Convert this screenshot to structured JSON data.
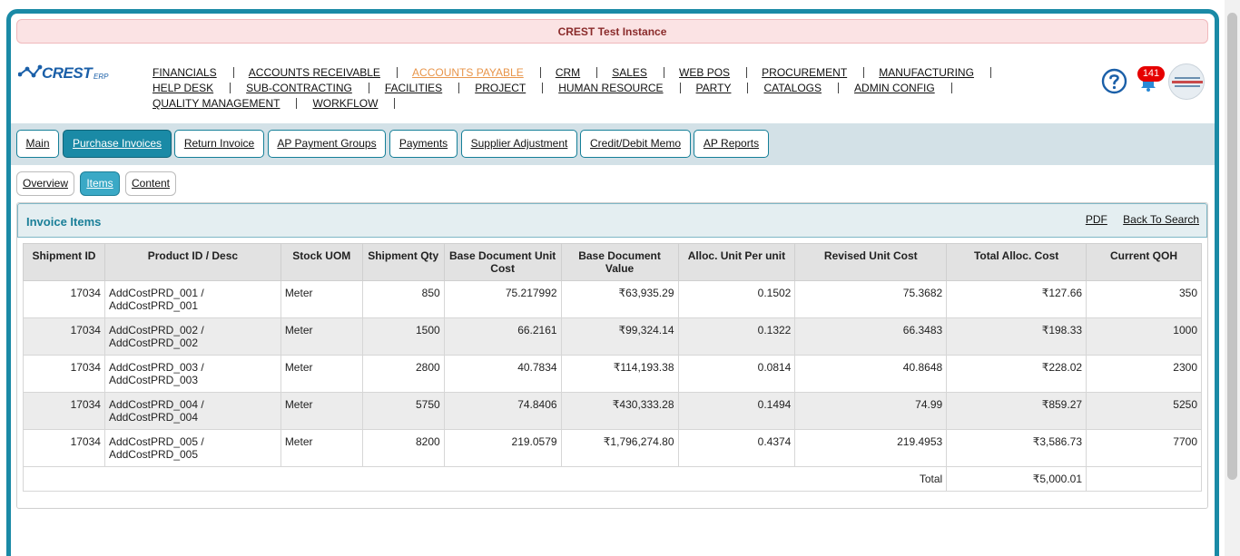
{
  "banner": "CREST Test Instance",
  "logo": {
    "text": "CREST",
    "suffix": "ERP"
  },
  "nav": {
    "rows": [
      [
        "FINANCIALS",
        "ACCOUNTS RECEIVABLE",
        "ACCOUNTS PAYABLE",
        "CRM",
        "SALES",
        "WEB POS",
        "PROCUREMENT",
        "MANUFACTURING"
      ],
      [
        "HELP DESK",
        "SUB-CONTRACTING",
        "FACILITIES",
        "PROJECT",
        "HUMAN RESOURCE",
        "PARTY",
        "CATALOGS",
        "ADMIN CONFIG"
      ],
      [
        "QUALITY MANAGEMENT",
        "WORKFLOW"
      ]
    ],
    "active": "ACCOUNTS PAYABLE"
  },
  "header": {
    "notification_count": "141",
    "help_icon": "question-circle-icon",
    "bell_icon": "bell-icon"
  },
  "tabs": [
    "Main",
    "Purchase Invoices",
    "Return Invoice",
    "AP Payment Groups",
    "Payments",
    "Supplier Adjustment",
    "Credit/Debit Memo",
    "AP Reports"
  ],
  "active_tab": "Purchase Invoices",
  "subtabs": [
    "Overview",
    "Items",
    "Content"
  ],
  "active_subtab": "Items",
  "panel": {
    "title": "Invoice Items",
    "pdf_link": "PDF",
    "back_link": "Back To Search"
  },
  "table": {
    "headers": [
      "Shipment ID",
      "Product ID / Desc",
      "Stock UOM",
      "Shipment Qty",
      "Base Document Unit Cost",
      "Base Document Value",
      "Alloc. Unit Per unit",
      "Revised Unit Cost",
      "Total Alloc. Cost",
      "Current QOH"
    ],
    "rows": [
      {
        "shipment_id": "17034",
        "product_line1": "AddCostPRD_001 /",
        "product_line2": "AddCostPRD_001",
        "uom": "Meter",
        "qty": "850",
        "unit_cost": "75.217992",
        "doc_value": "₹63,935.29",
        "alloc_unit": "0.1502",
        "revised_cost": "75.3682",
        "total_alloc": "₹127.66",
        "qoh": "350"
      },
      {
        "shipment_id": "17034",
        "product_line1": "AddCostPRD_002 /",
        "product_line2": "AddCostPRD_002",
        "uom": "Meter",
        "qty": "1500",
        "unit_cost": "66.2161",
        "doc_value": "₹99,324.14",
        "alloc_unit": "0.1322",
        "revised_cost": "66.3483",
        "total_alloc": "₹198.33",
        "qoh": "1000"
      },
      {
        "shipment_id": "17034",
        "product_line1": "AddCostPRD_003 /",
        "product_line2": "AddCostPRD_003",
        "uom": "Meter",
        "qty": "2800",
        "unit_cost": "40.7834",
        "doc_value": "₹114,193.38",
        "alloc_unit": "0.0814",
        "revised_cost": "40.8648",
        "total_alloc": "₹228.02",
        "qoh": "2300"
      },
      {
        "shipment_id": "17034",
        "product_line1": "AddCostPRD_004 /",
        "product_line2": "AddCostPRD_004",
        "uom": "Meter",
        "qty": "5750",
        "unit_cost": "74.8406",
        "doc_value": "₹430,333.28",
        "alloc_unit": "0.1494",
        "revised_cost": "74.99",
        "total_alloc": "₹859.27",
        "qoh": "5250"
      },
      {
        "shipment_id": "17034",
        "product_line1": "AddCostPRD_005 /",
        "product_line2": "AddCostPRD_005",
        "uom": "Meter",
        "qty": "8200",
        "unit_cost": "219.0579",
        "doc_value": "₹1,796,274.80",
        "alloc_unit": "0.4374",
        "revised_cost": "219.4953",
        "total_alloc": "₹3,586.73",
        "qoh": "7700"
      }
    ],
    "total_label": "Total",
    "total_value": "₹5,000.01"
  },
  "colors": {
    "accent": "#1a8aa6",
    "active_nav": "#e8954a",
    "banner_bg": "#fbe3e4",
    "badge": "#e60000"
  }
}
